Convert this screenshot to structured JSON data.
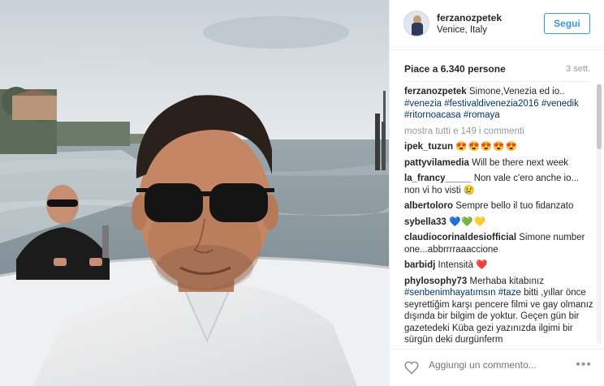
{
  "post": {
    "username": "ferzanozpetek",
    "location": "Venice, Italy",
    "follow_label": "Segui",
    "likes_text": "Piace a 6.340 persone",
    "time_ago": "3 sett.",
    "show_all_comments": "mostra tutti e 149 i commenti",
    "comment_placeholder": "Aggiungi un commento...",
    "more_options": "•••"
  },
  "caption": {
    "user": "ferzanozpetek",
    "text": "Simone,Venezia ed io..",
    "tags": [
      "#venezia",
      "#festivaldivenezia2016",
      "#venedik",
      "#ritornoacasa",
      "#romaya"
    ]
  },
  "comments": [
    {
      "user": "ipek_tuzun",
      "text": "😍😍😍😍😍"
    },
    {
      "user": "pattyvilamedia",
      "text": "Will be there next week"
    },
    {
      "user": "la_francy_____",
      "text": "Non vale c'ero anche io... non vi ho visti 😢"
    },
    {
      "user": "albertoloro",
      "text": "Sempre bello il tuo fidanzato"
    },
    {
      "user": "sybella33",
      "text": "💙💚💛"
    },
    {
      "user": "claudiocorinaldesiofficial",
      "text": "Simone number one...abbrrrraaaccione"
    },
    {
      "user": "barbidj",
      "text": "Intensità ❤️"
    },
    {
      "user": "phylosophy73",
      "text_a": "Merhaba kitabınız",
      "tag": "#senbenimhayatımsın",
      "tag2": "#taze",
      "text_b": "bitti ,yıllar önce seyrettiğim karşı pencere filmi ve gay olmanız dışında bir bilgim de yoktur. Geçen gün bir gazetedeki Küba gezi yazınızda ilgimi bir sürgün deki durgünferm"
    }
  ],
  "icons": {
    "avatar": "avatar",
    "like": "heart-outline-icon",
    "options": "more-dots-icon"
  },
  "colors": {
    "accent": "#3897f0",
    "hashtag": "#003569",
    "muted": "#999999"
  }
}
